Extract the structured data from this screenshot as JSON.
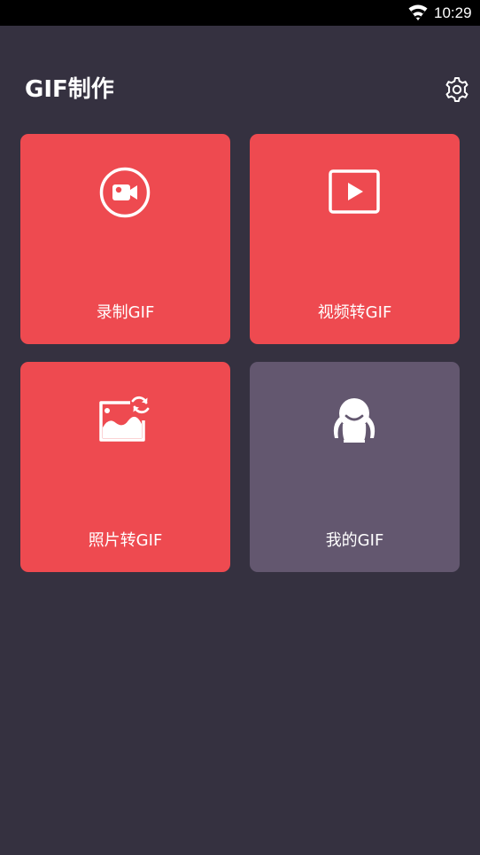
{
  "status_bar": {
    "time": "10:29",
    "wifi_icon": "wifi-icon"
  },
  "header": {
    "title": "GIF制作",
    "settings_icon": "gear-icon"
  },
  "tiles": [
    {
      "label": "录制GIF",
      "icon": "video-camera-icon",
      "color": "#ee4a50"
    },
    {
      "label": "视频转GIF",
      "icon": "play-icon",
      "color": "#ee4a50"
    },
    {
      "label": "照片转GIF",
      "icon": "image-refresh-icon",
      "color": "#ee4a50"
    },
    {
      "label": "我的GIF",
      "icon": "mascot-icon",
      "color": "#63576f"
    }
  ],
  "colors": {
    "background": "#353140",
    "accent": "#ee4a50",
    "secondary_tile": "#63576f"
  }
}
